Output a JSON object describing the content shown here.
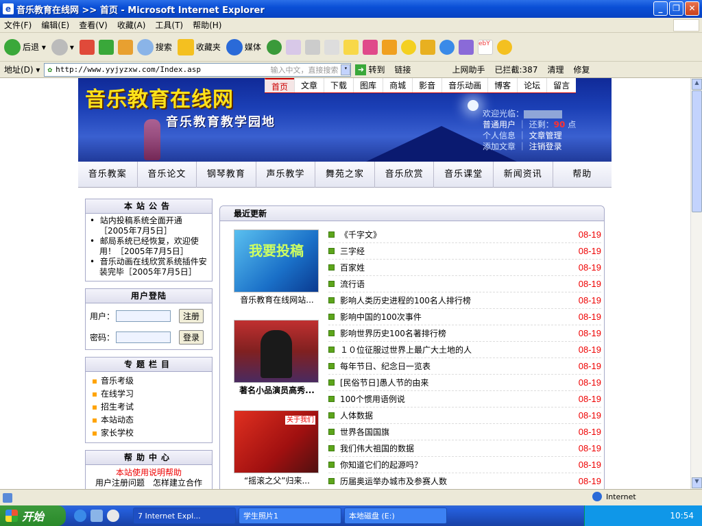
{
  "window": {
    "title": "音乐教育在线网 >> 首页 - Microsoft Internet Explorer"
  },
  "menu": [
    "文件(F)",
    "编辑(E)",
    "查看(V)",
    "收藏(A)",
    "工具(T)",
    "帮助(H)"
  ],
  "toolbar": {
    "back": "后退",
    "search": "搜索",
    "favorites": "收藏夹",
    "media": "媒体"
  },
  "address": {
    "label": "地址(D)",
    "url": "http://www.yyjyzxw.com/Index.asp",
    "placeholder": "输入中文，直接搜索",
    "go": "转到",
    "links": "链接",
    "helper": "上网助手",
    "blocked": "已拦截:387",
    "clean": "清理",
    "repair": "修复"
  },
  "status": {
    "zone": "Internet"
  },
  "taskbar": {
    "start": "开始",
    "tasks": [
      "7 Internet Expl...",
      "学生照片1",
      "本地磁盘 (E:)"
    ],
    "clock": "10:54"
  },
  "site": {
    "logo": "音乐教育在线网",
    "slogan": "音乐教育教学园地",
    "topnav": [
      "首页",
      "文章",
      "下载",
      "图库",
      "商城",
      "影音",
      "音乐动画",
      "博客",
      "论坛",
      "留言"
    ],
    "welcome": {
      "hi": "欢迎光临：",
      "role": "普通用户",
      "left": "还剩：",
      "points": "90",
      "unit": "点",
      "info": "个人信息",
      "manage": "文章管理",
      "add": "添加文章",
      "logout": "注销登录"
    },
    "mainnav": [
      "音乐教案",
      "音乐论文",
      "钢琴教育",
      "声乐教学",
      "舞苑之家",
      "音乐欣赏",
      "音乐课堂",
      "新闻资讯",
      "帮助"
    ],
    "notice": {
      "title": "本站公告",
      "items": [
        "站内投稿系统全面开通［2005年7月5日］",
        "邮局系统已经恢复，欢迎使用！［2005年7月5日］",
        "音乐动画在线欣赏系统插件安装完毕［2005年7月5日］"
      ]
    },
    "login": {
      "title": "用户登陆",
      "user": "用户：",
      "pass": "密码：",
      "register": "注册",
      "submit": "登录"
    },
    "topics": {
      "title": "专题栏目",
      "items": [
        "音乐考级",
        "在线学习",
        "招生考试",
        "本站动态",
        "家长学校"
      ]
    },
    "help": {
      "title": "帮助中心",
      "link": "本站使用说明帮助",
      "more": "用户注册问题　怎样建立合作"
    },
    "recent": {
      "title": "最近更新",
      "thumbs": [
        "音乐教育在线网站...",
        "著名小品演员高秀...",
        "“摇滚之父”归来..."
      ],
      "thumbText": [
        "我要投稿",
        "",
        "关于我们"
      ],
      "items": [
        {
          "t": "《千字文》",
          "d": "08-19"
        },
        {
          "t": "三字经",
          "d": "08-19"
        },
        {
          "t": "百家姓",
          "d": "08-19"
        },
        {
          "t": "流行语",
          "d": "08-19"
        },
        {
          "t": "影响人类历史进程的100名人排行榜",
          "d": "08-19"
        },
        {
          "t": "影响中国的100次事件",
          "d": "08-19"
        },
        {
          "t": "影响世界历史100名著排行榜",
          "d": "08-19"
        },
        {
          "t": "１０位征服过世界上最广大土地的人",
          "d": "08-19"
        },
        {
          "t": "每年节日、纪念日一览表",
          "d": "08-19"
        },
        {
          "t": "[民俗节日]愚人节的由来",
          "d": "08-19"
        },
        {
          "t": "100个惯用语例说",
          "d": "08-19"
        },
        {
          "t": "人体数据",
          "d": "08-19"
        },
        {
          "t": "世界各国国旗",
          "d": "08-19"
        },
        {
          "t": "我们伟大祖国的数据",
          "d": "08-19"
        },
        {
          "t": "你知道它们的起源吗？",
          "d": "08-19"
        },
        {
          "t": "历届奥运举办城市及参赛人数",
          "d": "08-19"
        }
      ]
    }
  }
}
